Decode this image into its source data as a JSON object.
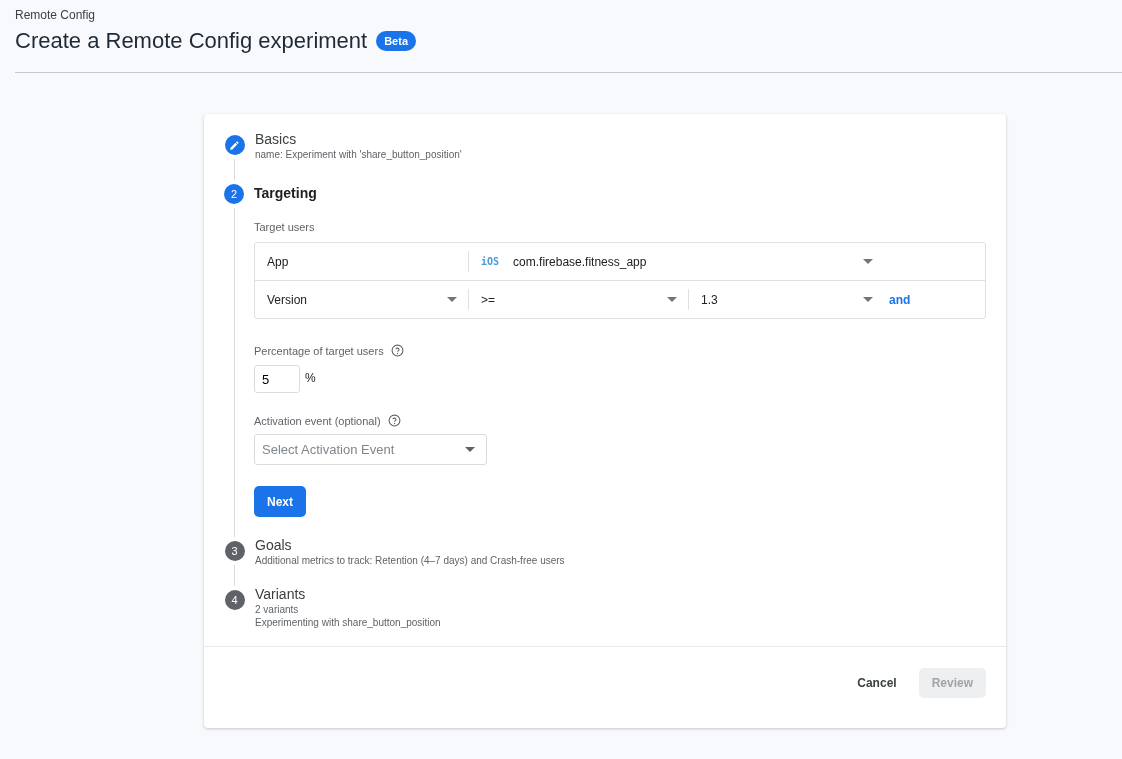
{
  "breadcrumb": "Remote Config",
  "title": "Create a Remote Config experiment",
  "badge": "Beta",
  "steps": [
    {
      "kind": "done",
      "title": "Basics",
      "lines": [
        "name: Experiment with 'share_button_position'"
      ]
    },
    {
      "kind": "active",
      "number": "2",
      "title": "Targeting"
    },
    {
      "kind": "pending",
      "number": "3",
      "title": "Goals",
      "lines": [
        "Additional metrics to track: Retention (4–7 days) and Crash-free users"
      ]
    },
    {
      "kind": "pending",
      "number": "4",
      "title": "Variants",
      "lines": [
        "2 variants",
        "Experimenting with share_button_position"
      ]
    }
  ],
  "targeting": {
    "label": "Target users",
    "rows": [
      {
        "field": {
          "text": "App",
          "dropdown": false
        },
        "cells": [
          {
            "platform": "iOS",
            "text": "com.firebase.fitness_app",
            "dropdown": true
          }
        ]
      },
      {
        "field": {
          "text": "Version",
          "dropdown": true
        },
        "cells": [
          {
            "text": ">=",
            "dropdown": true
          },
          {
            "text": "1.3",
            "dropdown": true
          }
        ],
        "link": "and"
      }
    ],
    "percentage": {
      "label": "Percentage of target users",
      "value": "5",
      "unit": "%"
    },
    "activation": {
      "label": "Activation event (optional)",
      "placeholder": "Select Activation Event"
    },
    "next": "Next"
  },
  "footer": {
    "cancel": "Cancel",
    "review": {
      "label": "Review",
      "disabled": true
    }
  }
}
